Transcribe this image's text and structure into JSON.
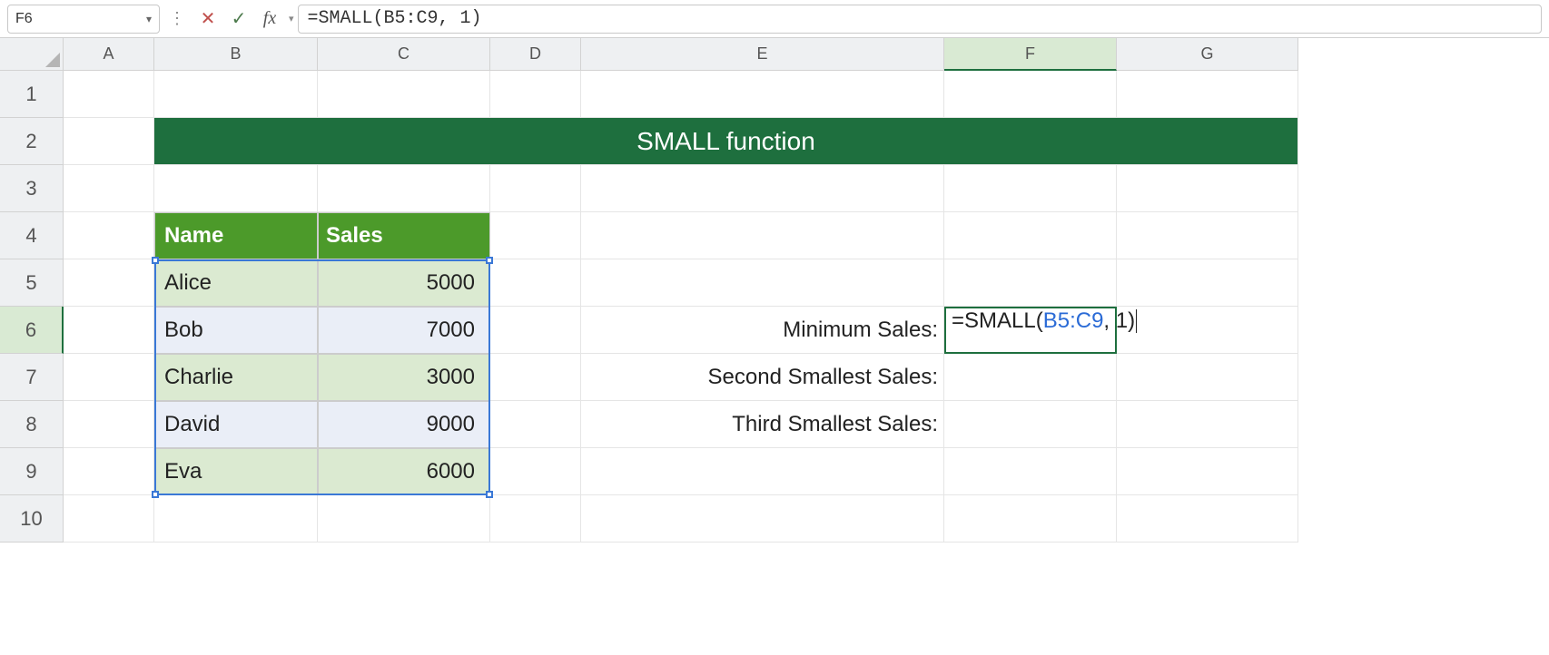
{
  "nameBox": "F6",
  "formulaBarText": "=SMALL(B5:C9, 1)",
  "columns": [
    "A",
    "B",
    "C",
    "D",
    "E",
    "F",
    "G"
  ],
  "rows": [
    "1",
    "2",
    "3",
    "4",
    "5",
    "6",
    "7",
    "8",
    "9",
    "10"
  ],
  "activeColumn": "F",
  "activeRow": "6",
  "title": "SMALL function",
  "table": {
    "headers": {
      "name": "Name",
      "sales": "Sales"
    },
    "rows": [
      {
        "name": "Alice",
        "sales": "5000"
      },
      {
        "name": "Bob",
        "sales": "7000"
      },
      {
        "name": "Charlie",
        "sales": "3000"
      },
      {
        "name": "David",
        "sales": "9000"
      },
      {
        "name": "Eva",
        "sales": "6000"
      }
    ]
  },
  "labels": {
    "min": "Minimum Sales:",
    "second": "Second Smallest Sales:",
    "third": "Third Smallest Sales:"
  },
  "cellFormula": {
    "prefix": "=SMALL(",
    "range": "B5:C9",
    "suffix": ", 1)"
  }
}
